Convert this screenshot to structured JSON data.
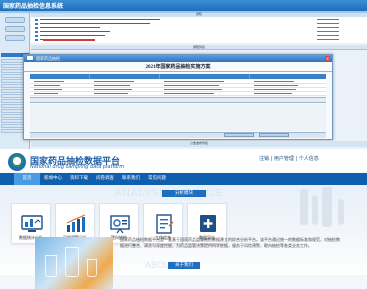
{
  "legacy": {
    "title": "国家药品抽检信息系统",
    "notice_header": "通知",
    "list_header": "通知列表",
    "bottom_label": "公告发布列表",
    "dialog": {
      "window_title": "国家药品抽检",
      "heading": "2021年国家药品抽检实施方案",
      "close_glyph": "×"
    }
  },
  "platform": {
    "brand_name": "国家药品抽检数据平台",
    "brand_subtitle": "National drug sampling data platform",
    "top_links": "注销 | 用户管理 | 个人信息",
    "nav": [
      "首页",
      "新闻中心",
      "资料下载",
      "问卷调查",
      "联系我们",
      "常见问题"
    ],
    "active_nav": 0,
    "section_watermark": "ANALYSIS MODULE",
    "section_title": "分析模块",
    "modules": [
      {
        "label": "数据统计分析",
        "icon": "chart-monitor-icon"
      },
      {
        "label": "风险预警分析",
        "icon": "bar-trend-icon"
      },
      {
        "label": "靶向抽检",
        "icon": "chart-board-icon"
      },
      {
        "label": "工作综合",
        "icon": "notebook-icon"
      },
      {
        "label": "数据导出",
        "icon": "plus-square-icon"
      }
    ],
    "about_watermark": "ABOUT US",
    "about_title": "关于我们",
    "about_text": "国家药品抽检数据平台是一套基于国家药品监督抽检数据建立的综合分析平台。该平台通过统一的数据标准和规范，对抽检数据进行整合、清洗与深度挖掘，为药品监管决策提供科学依据，服务于风险预警、靶向抽检等各类业务工作。"
  },
  "colors": {
    "nav_blue": "#0f5fae",
    "brand_blue": "#1f5fa6",
    "accent_blue": "#1f6fc0",
    "legacy_header": "#2f79c4"
  }
}
